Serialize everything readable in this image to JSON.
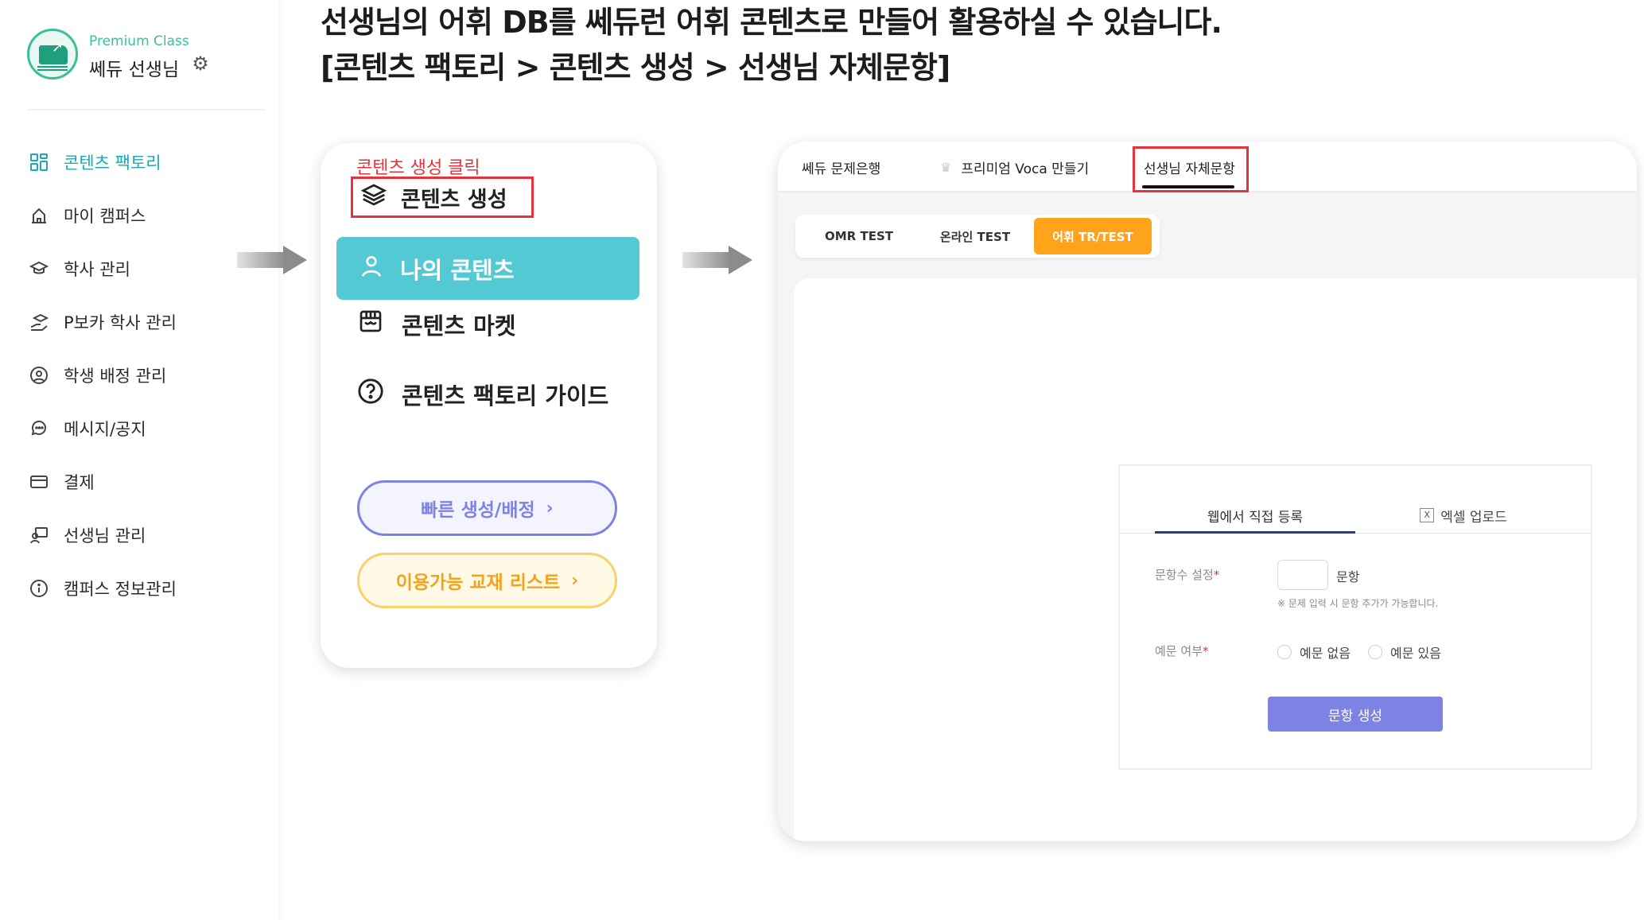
{
  "headline": {
    "line1": "선생님의 어휘 DB를 쎄듀런 어휘 콘텐츠로 만들어 활용하실 수 있습니다.",
    "line2": "[콘텐츠 팩토리 > 콘텐츠 생성 > 선생님 자체문항]"
  },
  "sidebar": {
    "class_label": "Premium Class",
    "teacher_name": "쎄듀 선생님",
    "items": [
      {
        "label": "콘텐츠 팩토리",
        "icon": "grid-icon"
      },
      {
        "label": "마이 캠퍼스",
        "icon": "campus-icon"
      },
      {
        "label": "학사 관리",
        "icon": "graduation-cap-icon"
      },
      {
        "label": "P보카 학사 관리",
        "icon": "graduation-hand-icon"
      },
      {
        "label": "학생 배정 관리",
        "icon": "user-circle-icon"
      },
      {
        "label": "메시지/공지",
        "icon": "chat-icon"
      },
      {
        "label": "결제",
        "icon": "card-icon"
      },
      {
        "label": "선생님 관리",
        "icon": "teacher-icon"
      },
      {
        "label": "캠퍼스 정보관리",
        "icon": "info-icon"
      }
    ]
  },
  "middle_menu": {
    "click_hint": "콘텐츠 생성 클릭",
    "create_label": "콘텐츠 생성",
    "my_content_label": "나의 콘텐츠",
    "market_label": "콘텐츠 마켓",
    "guide_label": "콘텐츠 팩토리 가이드",
    "quick_button": "빠른 생성/배정",
    "textbook_button": "이용가능 교재 리스트"
  },
  "right_panel": {
    "tabs": [
      "쎄듀 문제은행",
      "프리미엄 Voca 만들기",
      "선생님 자체문항"
    ],
    "segments": [
      "OMR TEST",
      "온라인 TEST",
      "어휘 TR/TEST"
    ],
    "form": {
      "tab_web": "웹에서 직접 등록",
      "tab_excel": "엑셀 업로드",
      "count_label": "문항수 설정",
      "count_unit": "문항",
      "count_note": "※ 문제 입력 시 문항 추가가 가능합니다.",
      "example_label": "예문 여부",
      "option_no": "예문 없음",
      "option_yes": "예문 있음",
      "required_mark": "*",
      "generate_button": "문항 생성"
    }
  },
  "colors": {
    "accent_teal": "#52c9d3",
    "highlight_red": "#e5323b",
    "orange": "#ffa31a",
    "purple": "#7d83e3"
  }
}
